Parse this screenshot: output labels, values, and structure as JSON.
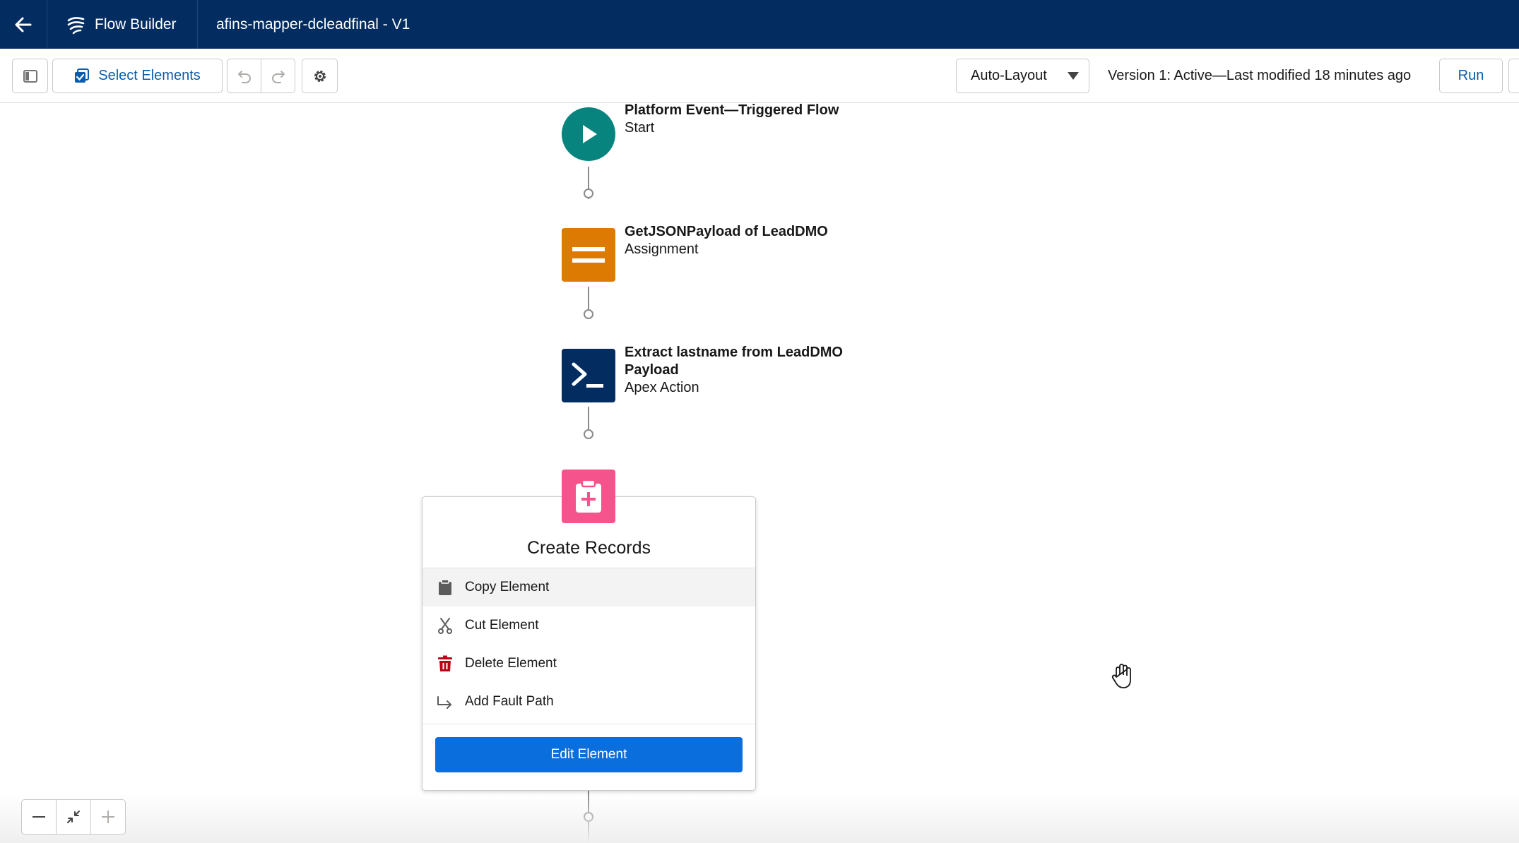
{
  "header": {
    "back_icon": "arrow-left-icon",
    "app_icon": "flow-icon",
    "app_label": "Flow Builder",
    "flow_title": "afins-mapper-dcleadfinal - V1"
  },
  "toolbar": {
    "panel_icon": "toggle-panel-icon",
    "select_elements_label": "Select Elements",
    "undo_icon": "undo-icon",
    "redo_icon": "redo-icon",
    "settings_icon": "gear-icon",
    "layout_value": "Auto-Layout",
    "version_text": "Version 1: Active—Last modified 18 minutes ago",
    "run_label": "Run"
  },
  "canvas": {
    "nodes": [
      {
        "title": "Platform Event—Triggered Flow",
        "type": "Start",
        "icon": "play-icon",
        "color": "#06847d"
      },
      {
        "title": "GetJSONPayload of LeadDMO",
        "type": "Assignment",
        "icon": "assignment-icon",
        "color": "#dd7a01"
      },
      {
        "title_line1": "Extract lastname from LeadDMO",
        "title_line2": "Payload",
        "type": "Apex Action",
        "icon": "apex-icon",
        "color": "#032d60"
      },
      {
        "icon": "create-records-icon",
        "color": "#f4548b"
      }
    ],
    "popover": {
      "title": "Create Records",
      "menu": [
        {
          "label": "Copy Element",
          "icon": "clipboard-icon"
        },
        {
          "label": "Cut Element",
          "icon": "scissors-icon"
        },
        {
          "label": "Delete Element",
          "icon": "trash-icon"
        },
        {
          "label": "Add Fault Path",
          "icon": "fault-path-icon"
        }
      ],
      "edit_label": "Edit Element"
    }
  },
  "zoom": {
    "zoom_out_icon": "minus-icon",
    "fit_icon": "fit-view-icon",
    "zoom_in_icon": "plus-icon"
  },
  "colors": {
    "header_bg": "#032d60",
    "brand_blue": "#0b5cab",
    "edit_button": "#0b6edd",
    "delete_red": "#ba0517"
  }
}
